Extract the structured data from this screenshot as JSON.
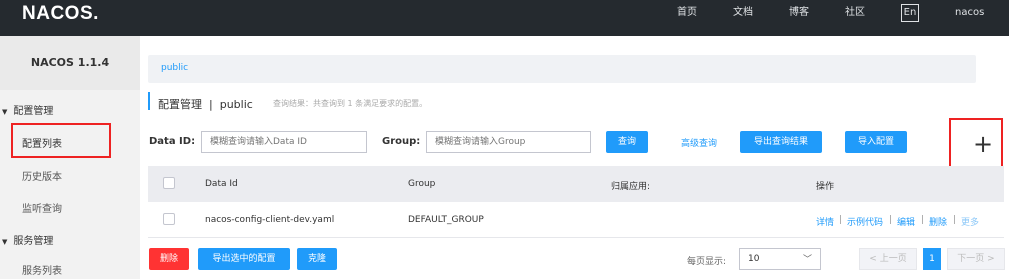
{
  "header": {
    "logo": "NACOS.",
    "nav": [
      "首页",
      "文档",
      "博客",
      "社区"
    ],
    "lang": "En",
    "user": "nacos"
  },
  "sidebar": {
    "version": "NACOS 1.1.4",
    "groups": [
      {
        "label": "配置管理",
        "items": [
          "配置列表",
          "历史版本",
          "监听查询"
        ]
      },
      {
        "label": "服务管理",
        "items": [
          "服务列表"
        ]
      }
    ]
  },
  "main": {
    "namespace": "public",
    "title": "配置管理",
    "title_sep": "|",
    "title_ns": "public",
    "hint": "查询结果：共查询到 1 条满足要求的配置。",
    "search": {
      "dataid_label": "Data ID:",
      "dataid_placeholder": "模糊查询请输入Data ID",
      "group_label": "Group:",
      "group_placeholder": "模糊查询请输入Group",
      "query_btn": "查询",
      "advanced_link": "高级查询",
      "export_btn": "导出查询结果",
      "import_btn": "导入配置",
      "add_icon": "+"
    },
    "table": {
      "headers": [
        "Data Id",
        "Group",
        "归属应用:",
        "操作"
      ],
      "rows": [
        {
          "data_id": "nacos-config-client-dev.yaml",
          "group": "DEFAULT_GROUP",
          "app": "",
          "ops": [
            "详情",
            "示例代码",
            "编辑",
            "删除",
            "更多"
          ]
        }
      ]
    },
    "footer": {
      "delete_btn": "删除",
      "export_selected_btn": "导出选中的配置",
      "clone_btn": "克隆",
      "per_page_label": "每页显示:",
      "per_page_value": "10",
      "prev": "< 上一页",
      "current_page": "1",
      "next": "下一页 >"
    }
  },
  "colors": {
    "accent": "#209bfa",
    "danger": "#ff3333",
    "highlight": "#e22"
  }
}
